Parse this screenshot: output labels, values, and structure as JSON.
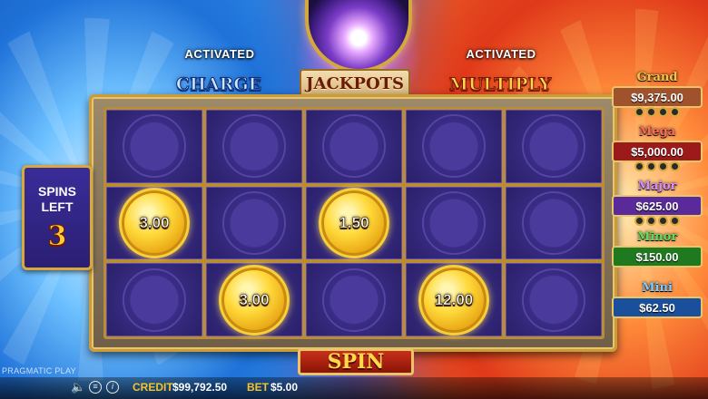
{
  "header": {
    "charge_status": "ACTIVATED",
    "charge_title": "CHARGE",
    "jackpots_title": "JACKPOTS",
    "multiply_status": "ACTIVATED",
    "multiply_title": "MULTIPLY"
  },
  "spins": {
    "label_line1": "SPINS",
    "label_line2": "LEFT",
    "count": "3"
  },
  "grid": {
    "rows": [
      [
        null,
        null,
        null,
        null,
        null
      ],
      [
        "3.00",
        null,
        "1.50",
        null,
        null
      ],
      [
        null,
        "3.00",
        null,
        "12.00",
        null
      ]
    ]
  },
  "jackpots": [
    {
      "name": "Grand",
      "value": "$9,375.00",
      "name_color": "#f4c74a",
      "box_color": "#a0522d"
    },
    {
      "name": "Mega",
      "value": "$5,000.00",
      "name_color": "#ff6a5a",
      "box_color": "#9c1a1a"
    },
    {
      "name": "Major",
      "value": "$625.00",
      "name_color": "#d98cff",
      "box_color": "#5a2a9a"
    },
    {
      "name": "Minor",
      "value": "$150.00",
      "name_color": "#5be05b",
      "box_color": "#1f7a1f"
    },
    {
      "name": "Mini",
      "value": "$62.50",
      "name_color": "#7ecbff",
      "box_color": "#1a4f9c"
    }
  ],
  "spin_button": "SPIN",
  "brand": "PRAGMATIC PLAY",
  "footer": {
    "credit_label": "CREDIT",
    "credit_value": "$99,792.50",
    "bet_label": "BET",
    "bet_value": "$5.00",
    "icons": [
      "speaker-icon",
      "menu-icon",
      "info-icon"
    ]
  },
  "colors": {
    "accent_gold": "#f6c42a",
    "coin_gold": "#e8a614",
    "cell_purple": "#33287a"
  }
}
